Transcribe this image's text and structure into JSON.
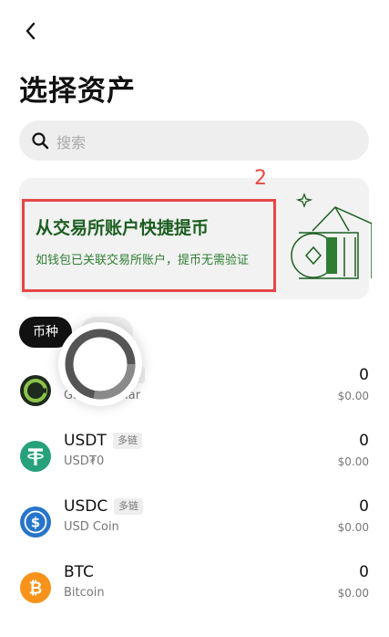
{
  "header": {
    "title": "选择资产"
  },
  "search": {
    "placeholder": "搜索"
  },
  "promo": {
    "step_marker": "2",
    "title": "从交易所账户快捷提币",
    "subtitle": "如钱包已关联交易所账户，提币无需验证",
    "accent": "#1b5e20"
  },
  "filters": {
    "active": "币种",
    "second": ""
  },
  "assets": [
    {
      "symbol": "",
      "tag": "链",
      "name": "Global Dollar",
      "balance": "0",
      "fiat": "$0.00",
      "icon": "global-dollar-icon",
      "color": "#1e2a1e"
    },
    {
      "symbol": "USDT",
      "tag": "多链",
      "name": "USD₮0",
      "balance": "0",
      "fiat": "$0.00",
      "icon": "usdt-icon",
      "color": "#26a17b"
    },
    {
      "symbol": "USDC",
      "tag": "多链",
      "name": "USD Coin",
      "balance": "0",
      "fiat": "$0.00",
      "icon": "usdc-icon",
      "color": "#2775ca"
    },
    {
      "symbol": "BTC",
      "tag": "",
      "name": "Bitcoin",
      "balance": "0",
      "fiat": "$0.00",
      "icon": "btc-icon",
      "color": "#f7931a"
    }
  ]
}
